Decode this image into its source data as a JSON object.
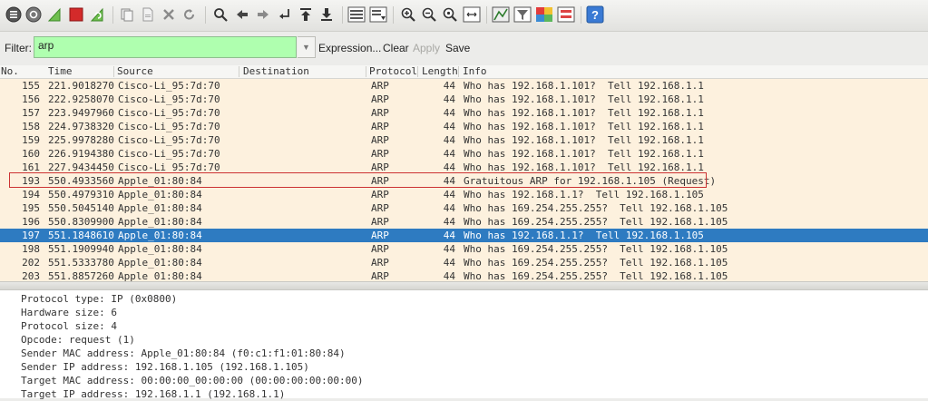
{
  "toolbar": {
    "icons": [
      "interface-list-icon",
      "capture-options-icon",
      "start-capture-icon",
      "stop-capture-icon",
      "restart-capture-icon",
      "open-file-icon",
      "save-file-icon",
      "close-file-icon",
      "reload-icon",
      "find-icon",
      "go-back-icon",
      "go-forward-icon",
      "go-to-packet-icon",
      "first-packet-icon",
      "last-packet-icon",
      "colorize-icon",
      "auto-scroll-icon",
      "zoom-in-icon",
      "zoom-out-icon",
      "normal-size-icon",
      "resize-columns-icon",
      "capture-filters-icon",
      "display-filters-icon",
      "coloring-rules-icon",
      "preferences-icon",
      "help-icon"
    ]
  },
  "filter": {
    "label": "Filter:",
    "value": "arp",
    "expression_label": "Expression...",
    "clear_label": "Clear",
    "apply_label": "Apply",
    "save_label": "Save"
  },
  "packet_list": {
    "columns": [
      "No.",
      "Time",
      "Source",
      "Destination",
      "Protocol",
      "Length",
      "Info"
    ],
    "rows": [
      {
        "no": "155",
        "time": "221.9018270",
        "source": "Cisco-Li_95:7d:70",
        "destination": "",
        "protocol": "ARP",
        "length": "44",
        "info": "Who has 192.168.1.101?  Tell 192.168.1.1"
      },
      {
        "no": "156",
        "time": "222.9258070",
        "source": "Cisco-Li_95:7d:70",
        "destination": "",
        "protocol": "ARP",
        "length": "44",
        "info": "Who has 192.168.1.101?  Tell 192.168.1.1"
      },
      {
        "no": "157",
        "time": "223.9497960",
        "source": "Cisco-Li_95:7d:70",
        "destination": "",
        "protocol": "ARP",
        "length": "44",
        "info": "Who has 192.168.1.101?  Tell 192.168.1.1"
      },
      {
        "no": "158",
        "time": "224.9738320",
        "source": "Cisco-Li_95:7d:70",
        "destination": "",
        "protocol": "ARP",
        "length": "44",
        "info": "Who has 192.168.1.101?  Tell 192.168.1.1"
      },
      {
        "no": "159",
        "time": "225.9978280",
        "source": "Cisco-Li_95:7d:70",
        "destination": "",
        "protocol": "ARP",
        "length": "44",
        "info": "Who has 192.168.1.101?  Tell 192.168.1.1"
      },
      {
        "no": "160",
        "time": "226.9194380",
        "source": "Cisco-Li_95:7d:70",
        "destination": "",
        "protocol": "ARP",
        "length": "44",
        "info": "Who has 192.168.1.101?  Tell 192.168.1.1"
      },
      {
        "no": "161",
        "time": "227.9434450",
        "source": "Cisco-Li_95:7d:70",
        "destination": "",
        "protocol": "ARP",
        "length": "44",
        "info": "Who has 192.168.1.101?  Tell 192.168.1.1"
      },
      {
        "no": "193",
        "time": "550.4933560",
        "source": "Apple_01:80:84",
        "destination": "",
        "protocol": "ARP",
        "length": "44",
        "info": "Gratuitous ARP for 192.168.1.105 (Request)"
      },
      {
        "no": "194",
        "time": "550.4979310",
        "source": "Apple_01:80:84",
        "destination": "",
        "protocol": "ARP",
        "length": "44",
        "info": "Who has 192.168.1.1?  Tell 192.168.1.105"
      },
      {
        "no": "195",
        "time": "550.5045140",
        "source": "Apple_01:80:84",
        "destination": "",
        "protocol": "ARP",
        "length": "44",
        "info": "Who has 169.254.255.255?  Tell 192.168.1.105"
      },
      {
        "no": "196",
        "time": "550.8309900",
        "source": "Apple_01:80:84",
        "destination": "",
        "protocol": "ARP",
        "length": "44",
        "info": "Who has 169.254.255.255?  Tell 192.168.1.105"
      },
      {
        "no": "197",
        "time": "551.1848610",
        "source": "Apple_01:80:84",
        "destination": "",
        "protocol": "ARP",
        "length": "44",
        "info": "Who has 192.168.1.1?  Tell 192.168.1.105"
      },
      {
        "no": "198",
        "time": "551.1909940",
        "source": "Apple_01:80:84",
        "destination": "",
        "protocol": "ARP",
        "length": "44",
        "info": "Who has 169.254.255.255?  Tell 192.168.1.105"
      },
      {
        "no": "202",
        "time": "551.5333780",
        "source": "Apple_01:80:84",
        "destination": "",
        "protocol": "ARP",
        "length": "44",
        "info": "Who has 169.254.255.255?  Tell 192.168.1.105"
      },
      {
        "no": "203",
        "time": "551.8857260",
        "source": "Apple_01:80:84",
        "destination": "",
        "protocol": "ARP",
        "length": "44",
        "info": "Who has 169.254.255.255?  Tell 192.168.1.105"
      }
    ],
    "selected_no": "197",
    "highlighted_no": "193",
    "row_color": "#fdf1de",
    "selected_color": "#2e7bc1"
  },
  "details": {
    "lines": [
      "Protocol type: IP (0x0800)",
      "Hardware size: 6",
      "Protocol size: 4",
      "Opcode: request (1)",
      "Sender MAC address: Apple_01:80:84 (f0:c1:f1:01:80:84)",
      "Sender IP address: 192.168.1.105 (192.168.1.105)",
      "Target MAC address: 00:00:00_00:00:00 (00:00:00:00:00:00)",
      "Target IP address: 192.168.1.1 (192.168.1.1)"
    ]
  }
}
